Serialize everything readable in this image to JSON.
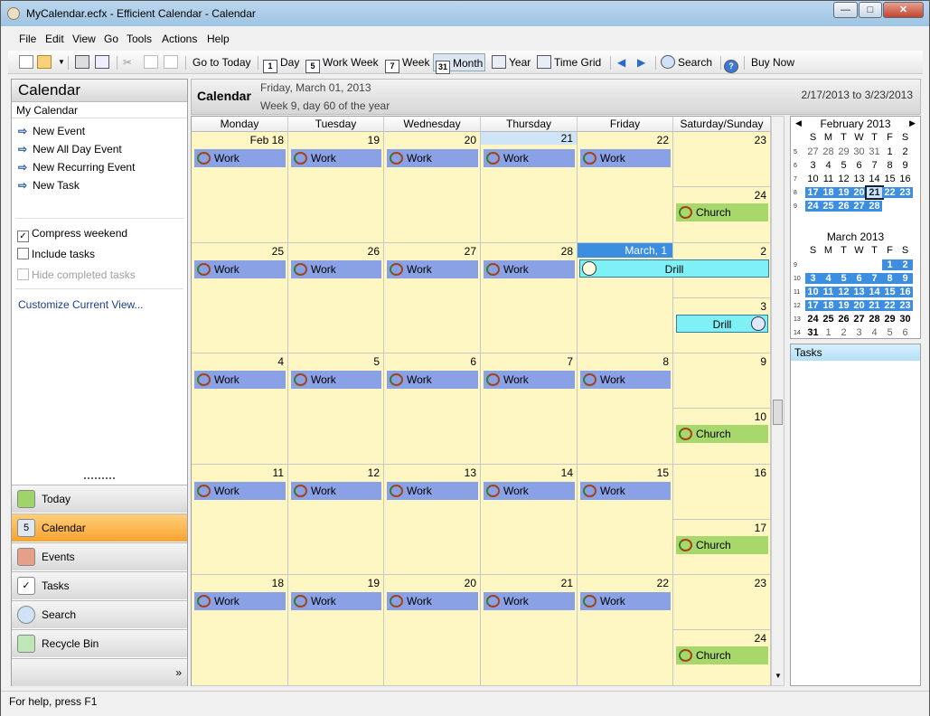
{
  "window": {
    "title": "MyCalendar.ecfx - Efficient Calendar - Calendar",
    "controls": [
      "—",
      "□",
      "✕"
    ]
  },
  "menu": [
    "File",
    "Edit",
    "View",
    "Go",
    "Tools",
    "Actions",
    "Help"
  ],
  "toolbar": {
    "go_to_today": "Go to Today",
    "day": "Day",
    "work_week": "Work Week",
    "week": "Week",
    "month": "Month",
    "year": "Year",
    "time_grid": "Time Grid",
    "search": "Search",
    "buy_now": "Buy Now",
    "icons": {
      "day": "1",
      "work_week": "5",
      "week": "7",
      "month": "31"
    }
  },
  "left_panel": {
    "title": "Calendar",
    "subtitle": "My Calendar",
    "links": [
      "New Event",
      "New All Day Event",
      "New Recurring Event",
      "New Task"
    ],
    "checkboxes": [
      {
        "label": "Compress weekend",
        "checked": true,
        "disabled": false
      },
      {
        "label": "Include tasks",
        "checked": false,
        "disabled": false
      },
      {
        "label": "Hide completed tasks",
        "checked": false,
        "disabled": true
      }
    ],
    "customize": "Customize Current View...",
    "nav": [
      "Today",
      "Calendar",
      "Events",
      "Tasks",
      "Search",
      "Recycle Bin"
    ],
    "active_nav": "Calendar"
  },
  "header": {
    "title": "Calendar",
    "date": "Friday, March 01, 2013",
    "week_info": "Week 9, day 60 of the year",
    "range": "2/17/2013 to 3/23/2013"
  },
  "day_headers": [
    "Monday",
    "Tuesday",
    "Wednesday",
    "Thursday",
    "Friday",
    "Saturday/Sunday"
  ],
  "weeks": [
    {
      "days": [
        "Feb 18",
        "19",
        "20",
        "21",
        "22"
      ],
      "sat": "23",
      "sun": "24",
      "sun_event": "Church"
    },
    {
      "days": [
        "25",
        "26",
        "27",
        "28",
        "March, 1"
      ],
      "sat": "2",
      "sun": "3",
      "sun_event": "Drill"
    },
    {
      "days": [
        "4",
        "5",
        "6",
        "7",
        "8"
      ],
      "sat": "9",
      "sun": "10",
      "sun_event": "Church"
    },
    {
      "days": [
        "11",
        "12",
        "13",
        "14",
        "15"
      ],
      "sat": "16",
      "sun": "17",
      "sun_event": "Church"
    },
    {
      "days": [
        "18",
        "19",
        "20",
        "21",
        "22"
      ],
      "sat": "23",
      "sun": "24",
      "sun_event": "Church"
    }
  ],
  "event_labels": {
    "work": "Work",
    "church": "Church",
    "drill": "Drill"
  },
  "mini_calendars": [
    {
      "title": "February 2013",
      "dow": [
        "S",
        "M",
        "T",
        "W",
        "T",
        "F",
        "S"
      ],
      "weeks": [
        {
          "wk": "5",
          "days": [
            "27",
            "28",
            "29",
            "30",
            "31",
            "1",
            "2"
          ]
        },
        {
          "wk": "6",
          "days": [
            "3",
            "4",
            "5",
            "6",
            "7",
            "8",
            "9"
          ]
        },
        {
          "wk": "7",
          "days": [
            "10",
            "11",
            "12",
            "13",
            "14",
            "15",
            "16"
          ]
        },
        {
          "wk": "8",
          "days": [
            "17",
            "18",
            "19",
            "20",
            "21",
            "22",
            "23"
          ]
        },
        {
          "wk": "9",
          "days": [
            "24",
            "25",
            "26",
            "27",
            "28",
            "",
            ""
          ]
        }
      ]
    },
    {
      "title": "March 2013",
      "dow": [
        "S",
        "M",
        "T",
        "W",
        "T",
        "F",
        "S"
      ],
      "weeks": [
        {
          "wk": "9",
          "days": [
            "",
            "",
            "",
            "",
            "",
            "1",
            "2"
          ]
        },
        {
          "wk": "10",
          "days": [
            "3",
            "4",
            "5",
            "6",
            "7",
            "8",
            "9"
          ]
        },
        {
          "wk": "11",
          "days": [
            "10",
            "11",
            "12",
            "13",
            "14",
            "15",
            "16"
          ]
        },
        {
          "wk": "12",
          "days": [
            "17",
            "18",
            "19",
            "20",
            "21",
            "22",
            "23"
          ]
        },
        {
          "wk": "13",
          "days": [
            "24",
            "25",
            "26",
            "27",
            "28",
            "29",
            "30"
          ]
        },
        {
          "wk": "14",
          "days": [
            "31",
            "1",
            "2",
            "3",
            "4",
            "5",
            "6"
          ]
        }
      ]
    }
  ],
  "tasks": {
    "title": "Tasks"
  },
  "status": "For help, press F1",
  "colors": {
    "work": "#8aa1e6",
    "church": "#a8d86c",
    "drill": "#7ef0f6",
    "cell": "#fef7c4",
    "selected": "#3b8ee0",
    "active_nav": "#f7a32e"
  }
}
